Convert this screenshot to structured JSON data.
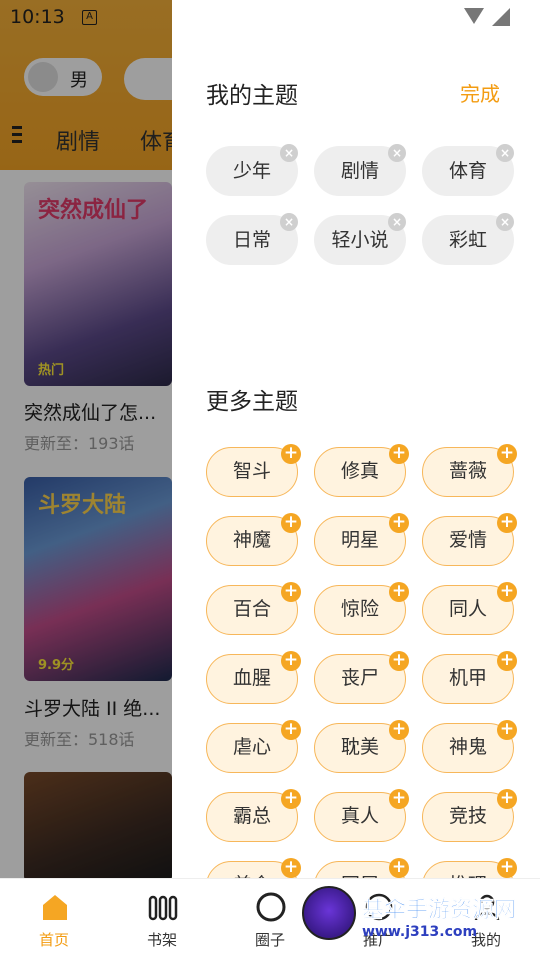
{
  "status_bar": {
    "time": "10:13",
    "notif_glyph": "A"
  },
  "background": {
    "gender_label": "男",
    "tabs": [
      "剧情",
      "体育"
    ],
    "books": [
      {
        "cover_text": "突然成仙了",
        "cover_badge": "热门",
        "title": "突然成仙了怎...",
        "update": "更新至：193话"
      },
      {
        "cover_text": "斗罗大陆",
        "cover_badge": "9.9分",
        "title": "斗罗大陆 II 绝...",
        "update": "更新至：518话"
      },
      {
        "cover_text": "",
        "cover_badge": "",
        "title": "",
        "update": ""
      }
    ]
  },
  "drawer": {
    "my_topics_title": "我的主题",
    "done_label": "完成",
    "my_topics": [
      "少年",
      "剧情",
      "体育",
      "日常",
      "轻小说",
      "彩虹"
    ],
    "more_topics_title": "更多主题",
    "more_topics": [
      "智斗",
      "修真",
      "蔷薇",
      "神魔",
      "明星",
      "爱情",
      "百合",
      "惊险",
      "同人",
      "血腥",
      "丧尸",
      "机甲",
      "虐心",
      "耽美",
      "神鬼",
      "霸总",
      "真人",
      "竞技",
      "美食",
      "同居",
      "推理"
    ]
  },
  "bottom_nav": {
    "items": [
      {
        "label": "首页",
        "icon": "home-icon",
        "active": true
      },
      {
        "label": "书架",
        "icon": "bookshelf-icon",
        "active": false
      },
      {
        "label": "圈子",
        "icon": "circle-icon",
        "active": false
      },
      {
        "label": "推广",
        "icon": "promote-icon",
        "active": false
      },
      {
        "label": "我的",
        "icon": "profile-icon",
        "active": false
      }
    ]
  },
  "watermark": {
    "text": "基伞手游资源网",
    "url": "www.j313.com"
  },
  "colors": {
    "accent": "#f39c12",
    "chip_more_bg": "#fff3df",
    "chip_mine_bg": "#eeeeee"
  }
}
